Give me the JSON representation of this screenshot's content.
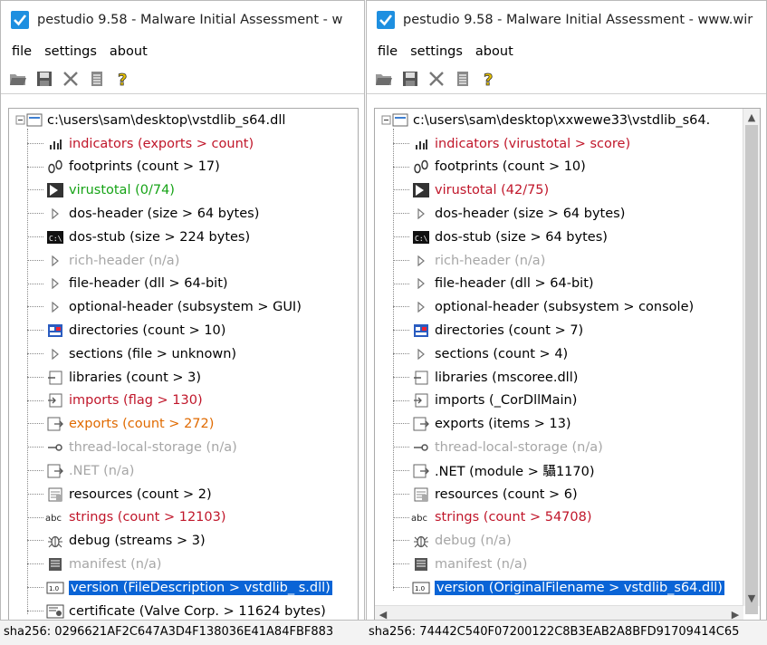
{
  "left": {
    "title": "pestudio 9.58 - Malware Initial Assessment - w",
    "menu": [
      "file",
      "settings",
      "about"
    ],
    "root": "c:\\users\\sam\\desktop\\vstdlib_s64.dll",
    "items": [
      {
        "icon": "chart-icon",
        "label": "indicators (exports > count)",
        "color": "red"
      },
      {
        "icon": "footprints-icon",
        "label": "footprints (count > 17)",
        "color": "black"
      },
      {
        "icon": "virustotal-icon",
        "label": "virustotal (0/74)",
        "color": "green"
      },
      {
        "icon": "triangle-icon",
        "label": "dos-header (size > 64 bytes)",
        "color": "black"
      },
      {
        "icon": "console-icon",
        "label": "dos-stub (size > 224 bytes)",
        "color": "black"
      },
      {
        "icon": "triangle-icon",
        "label": "rich-header (n/a)",
        "color": "gray"
      },
      {
        "icon": "triangle-icon",
        "label": "file-header (dll > 64-bit)",
        "color": "black"
      },
      {
        "icon": "triangle-icon",
        "label": "optional-header (subsystem > GUI)",
        "color": "black"
      },
      {
        "icon": "directories-icon",
        "label": "directories (count > 10)",
        "color": "black"
      },
      {
        "icon": "triangle-icon",
        "label": "sections (file > unknown)",
        "color": "black"
      },
      {
        "icon": "libraries-icon",
        "label": "libraries (count > 3)",
        "color": "black"
      },
      {
        "icon": "imports-icon",
        "label": "imports (flag > 130)",
        "color": "red"
      },
      {
        "icon": "exports-icon",
        "label": "exports (count > 272)",
        "color": "orange"
      },
      {
        "icon": "tls-icon",
        "label": "thread-local-storage (n/a)",
        "color": "gray"
      },
      {
        "icon": "exports-icon",
        "label": ".NET (n/a)",
        "color": "gray"
      },
      {
        "icon": "resources-icon",
        "label": "resources (count > 2)",
        "color": "black"
      },
      {
        "icon": "abc-icon",
        "label": "strings (count > 12103)",
        "color": "red"
      },
      {
        "icon": "bug-icon",
        "label": "debug (streams > 3)",
        "color": "black"
      },
      {
        "icon": "manifest-icon",
        "label": "manifest (n/a)",
        "color": "gray"
      },
      {
        "icon": "version-icon",
        "label": "version (FileDescription > vstdlib_ s.dll)",
        "color": "selected"
      },
      {
        "icon": "certificate-icon",
        "label": "certificate (Valve Corp. > 11624 bytes)",
        "color": "black"
      }
    ],
    "status": "sha256: 0296621AF2C647A3D4F138036E41A84FBF883"
  },
  "right": {
    "title": "pestudio 9.58 - Malware Initial Assessment - www.wir",
    "menu": [
      "file",
      "settings",
      "about"
    ],
    "root": "c:\\users\\sam\\desktop\\xxwewe33\\vstdlib_s64.",
    "items": [
      {
        "icon": "chart-icon",
        "label": "indicators (virustotal > score)",
        "color": "red"
      },
      {
        "icon": "footprints-icon",
        "label": "footprints (count > 10)",
        "color": "black"
      },
      {
        "icon": "virustotal-icon",
        "label": "virustotal (42/75)",
        "color": "red"
      },
      {
        "icon": "triangle-icon",
        "label": "dos-header (size > 64 bytes)",
        "color": "black"
      },
      {
        "icon": "console-icon",
        "label": "dos-stub (size > 64 bytes)",
        "color": "black"
      },
      {
        "icon": "triangle-icon",
        "label": "rich-header (n/a)",
        "color": "gray"
      },
      {
        "icon": "triangle-icon",
        "label": "file-header (dll > 64-bit)",
        "color": "black"
      },
      {
        "icon": "triangle-icon",
        "label": "optional-header (subsystem > console)",
        "color": "black"
      },
      {
        "icon": "directories-icon",
        "label": "directories (count > 7)",
        "color": "black"
      },
      {
        "icon": "triangle-icon",
        "label": "sections (count > 4)",
        "color": "black"
      },
      {
        "icon": "libraries-icon",
        "label": "libraries (mscoree.dll)",
        "color": "black"
      },
      {
        "icon": "imports-icon",
        "label": "imports (_CorDllMain)",
        "color": "black"
      },
      {
        "icon": "exports-icon",
        "label": "exports (items > 13)",
        "color": "black"
      },
      {
        "icon": "tls-icon",
        "label": "thread-local-storage (n/a)",
        "color": "gray"
      },
      {
        "icon": "exports-icon",
        "label": ".NET (module > 䯀1170)",
        "color": "black"
      },
      {
        "icon": "resources-icon",
        "label": "resources (count > 6)",
        "color": "black"
      },
      {
        "icon": "abc-icon",
        "label": "strings (count > 54708)",
        "color": "red"
      },
      {
        "icon": "bug-icon",
        "label": "debug (n/a)",
        "color": "gray"
      },
      {
        "icon": "manifest-icon",
        "label": "manifest (n/a)",
        "color": "gray"
      },
      {
        "icon": "version-icon",
        "label": "version (OriginalFilename > vstdlib_s64.dll)",
        "color": "selected"
      }
    ],
    "status": "sha256: 74442C540F07200122C8B3EAB2A8BFD91709414C65"
  },
  "colors": {
    "red": "#c0162a",
    "green": "#16a316",
    "orange": "#e06a00",
    "gray": "#a6a6a6",
    "selected": "#0a64d6",
    "app_icon": "#1e8fe0"
  }
}
